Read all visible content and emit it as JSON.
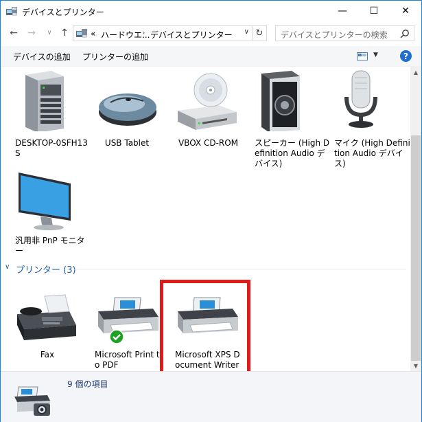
{
  "window": {
    "title": "デバイスとプリンター",
    "controls": {
      "minimize": "—",
      "maximize": "☐",
      "close": "✕"
    }
  },
  "nav": {
    "back": "←",
    "forward": "→",
    "recent": "∨",
    "up": "↑",
    "breadcrumb": {
      "overflow": "«",
      "parent": "ハードウエ...",
      "separator": "›",
      "current": "デバイスとプリンター",
      "dropdown": "∨"
    },
    "refresh": "↻",
    "search_placeholder": "デバイスとプリンターの検索"
  },
  "commands": {
    "add_device": "デバイスの追加",
    "add_printer": "プリンターの追加",
    "view_dropdown": "▼",
    "help": "?"
  },
  "devices": [
    {
      "label": "DESKTOP-0SFH13S",
      "icon": "computer-tower-icon"
    },
    {
      "label": "USB Tablet",
      "icon": "mouse-icon"
    },
    {
      "label": "VBOX CD-ROM",
      "icon": "cd-drive-icon"
    },
    {
      "label": "スピーカー (High Definition Audio デバイス)",
      "icon": "speaker-icon"
    },
    {
      "label": "マイク (High Definition Audio デバイス)",
      "icon": "microphone-icon"
    },
    {
      "label": "汎用非 PnP モニター",
      "icon": "monitor-icon"
    }
  ],
  "printers_group": {
    "title": "プリンター (3)",
    "chevron": "∨",
    "items": [
      {
        "label": "Fax",
        "icon": "fax-icon",
        "default": false
      },
      {
        "label": "Microsoft Print to PDF",
        "icon": "printer-icon",
        "default": true
      },
      {
        "label": "Microsoft XPS Document Writer",
        "icon": "printer-icon",
        "default": false
      }
    ]
  },
  "details": {
    "count": "9 個の項目"
  },
  "scrollbar": {
    "up": "▲",
    "down": "▼"
  },
  "colors": {
    "accent": "#1e5aa8",
    "highlight": "#e11a1a",
    "default_check": "#1fa224"
  }
}
